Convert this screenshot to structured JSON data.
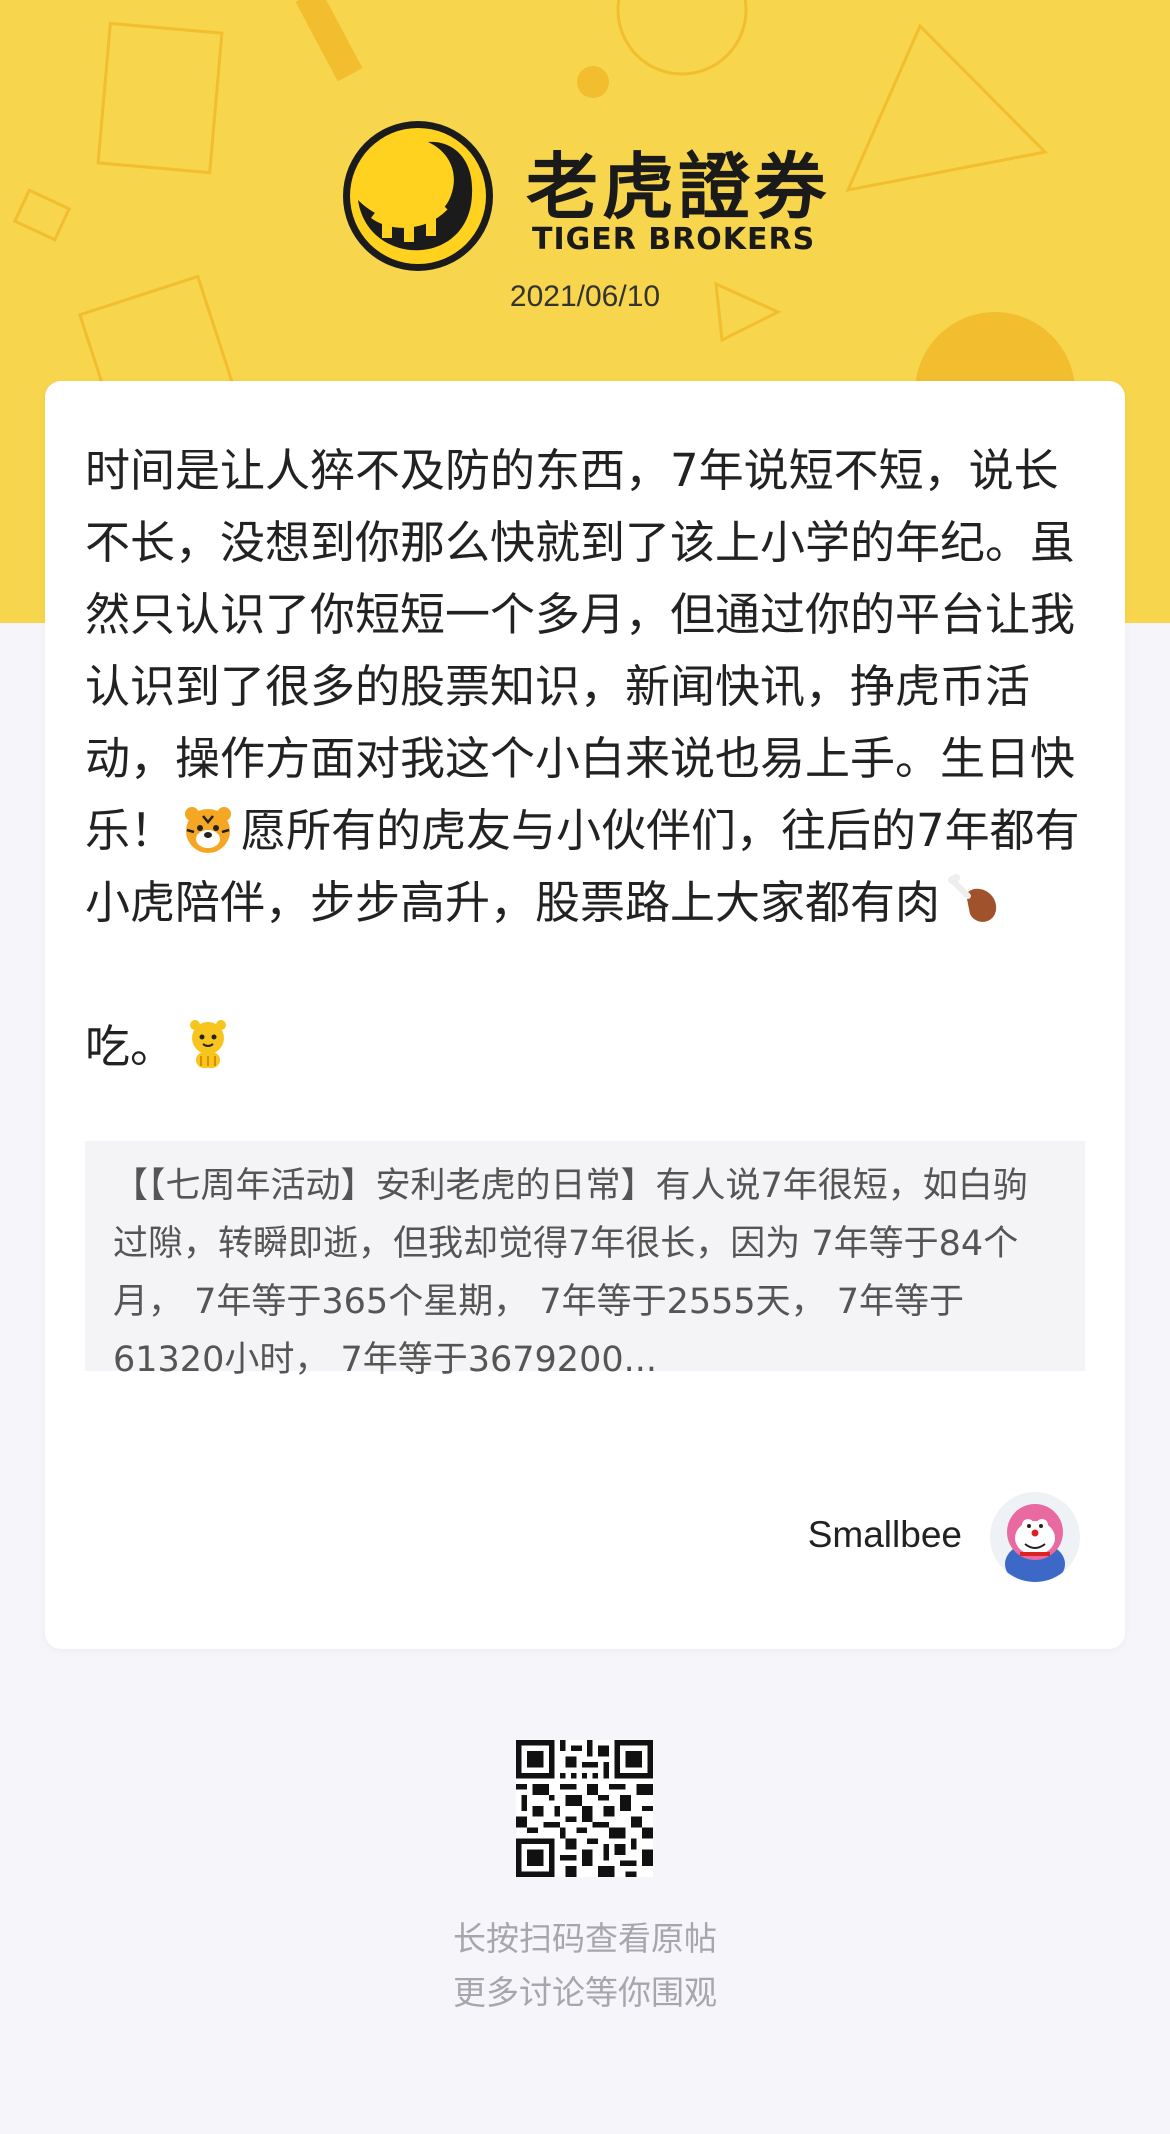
{
  "header": {
    "brand_cn": "老虎證券",
    "brand_en": "TIGER BROKERS",
    "date": "2021/06/10",
    "colors": {
      "background": "#f7d54d",
      "accent": "#f2bd2e"
    }
  },
  "post": {
    "body_part1": "时间是让人猝不及防的东西，7年说短不短，说长不长，没想到你那么快就到了该上小学的年纪。虽然只认识了你短短一个多月，但通过你的平台让我认识到了很多的股票知识，新闻快讯，挣虎币活动，操作方面对我这个小白来说也易上手。生日快乐！",
    "body_part2": "愿所有的虎友与小伙伴们，往后的7年都有小虎陪伴，步步高升，股票路上大家都有肉",
    "body_part3": "吃。",
    "emoji_1": "tiger-face-icon",
    "emoji_2": "chicken-leg-icon",
    "emoji_3": "tiger-mascot-icon",
    "quote": "【【七周年活动】安利老虎的日常】有人说7年很短，如白驹过隙，转瞬即逝，但我却觉得7年很长，因为 7年等于84个月， 7年等于365个星期， 7年等于2555天， 7年等于61320小时， 7年等于3679200...",
    "author": "Smallbee"
  },
  "footer": {
    "line1": "长按扫码查看原帖",
    "line2": "更多讨论等你围观"
  }
}
